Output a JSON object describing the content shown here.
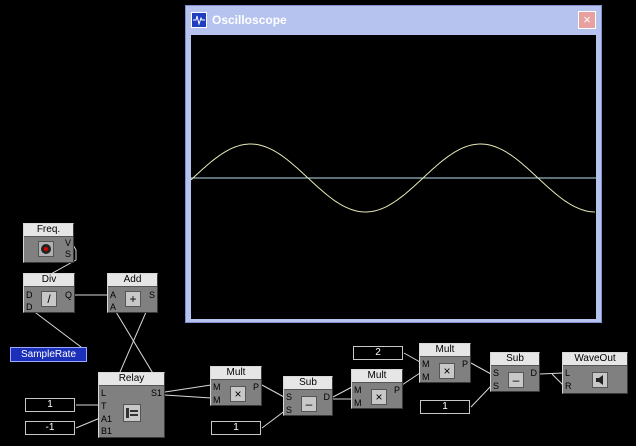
{
  "scope": {
    "title": "Oscilloscope",
    "close_glyph": "×",
    "icon": "waveform-icon",
    "trace_color": "#e9e9b8",
    "baseline_color": "#b8e0ee"
  },
  "modules": {
    "freq": {
      "title": "Freq.",
      "icon": "knob-icon",
      "pins": {
        "v": "V",
        "s": "S"
      }
    },
    "div": {
      "title": "Div",
      "icon": "divide-icon",
      "icon_glyph": "/",
      "pins": {
        "d1": "D",
        "d2": "D",
        "q": "Q"
      }
    },
    "add": {
      "title": "Add",
      "icon": "plus-icon",
      "icon_glyph": "+",
      "pins": {
        "a1": "A",
        "a2": "A",
        "s": "S"
      }
    },
    "relay": {
      "title": "Relay",
      "icon": "relay-switch-icon",
      "pins": {
        "l": "L",
        "t": "T",
        "a1": "A1",
        "b1": "B1",
        "s1": "S1"
      }
    },
    "mult1": {
      "title": "Mult",
      "icon": "multiply-icon",
      "icon_glyph": "×",
      "pins": {
        "m1": "M",
        "m2": "M",
        "p": "P"
      }
    },
    "sub1": {
      "title": "Sub",
      "icon": "minus-icon",
      "icon_glyph": "–",
      "pins": {
        "s1": "S",
        "s2": "S",
        "d": "D"
      }
    },
    "mult2": {
      "title": "Mult",
      "icon": "multiply-icon",
      "icon_glyph": "×",
      "pins": {
        "m1": "M",
        "m2": "M",
        "p": "P"
      }
    },
    "mult3": {
      "title": "Mult",
      "icon": "multiply-icon",
      "icon_glyph": "×",
      "pins": {
        "m1": "M",
        "m2": "M",
        "p": "P"
      }
    },
    "sub2": {
      "title": "Sub",
      "icon": "minus-icon",
      "icon_glyph": "–",
      "pins": {
        "s1": "S",
        "s2": "S",
        "d": "D"
      }
    },
    "waveout": {
      "title": "WaveOut",
      "icon": "speaker-icon",
      "pins": {
        "l": "L",
        "r": "R"
      }
    }
  },
  "constants": {
    "c1": "1",
    "cneg1": "-1",
    "c_sub1": "1",
    "c2": "2",
    "c_sub2": "1"
  },
  "samplerate": {
    "label": "SampleRate"
  },
  "wire_color": "#d8d8d8"
}
